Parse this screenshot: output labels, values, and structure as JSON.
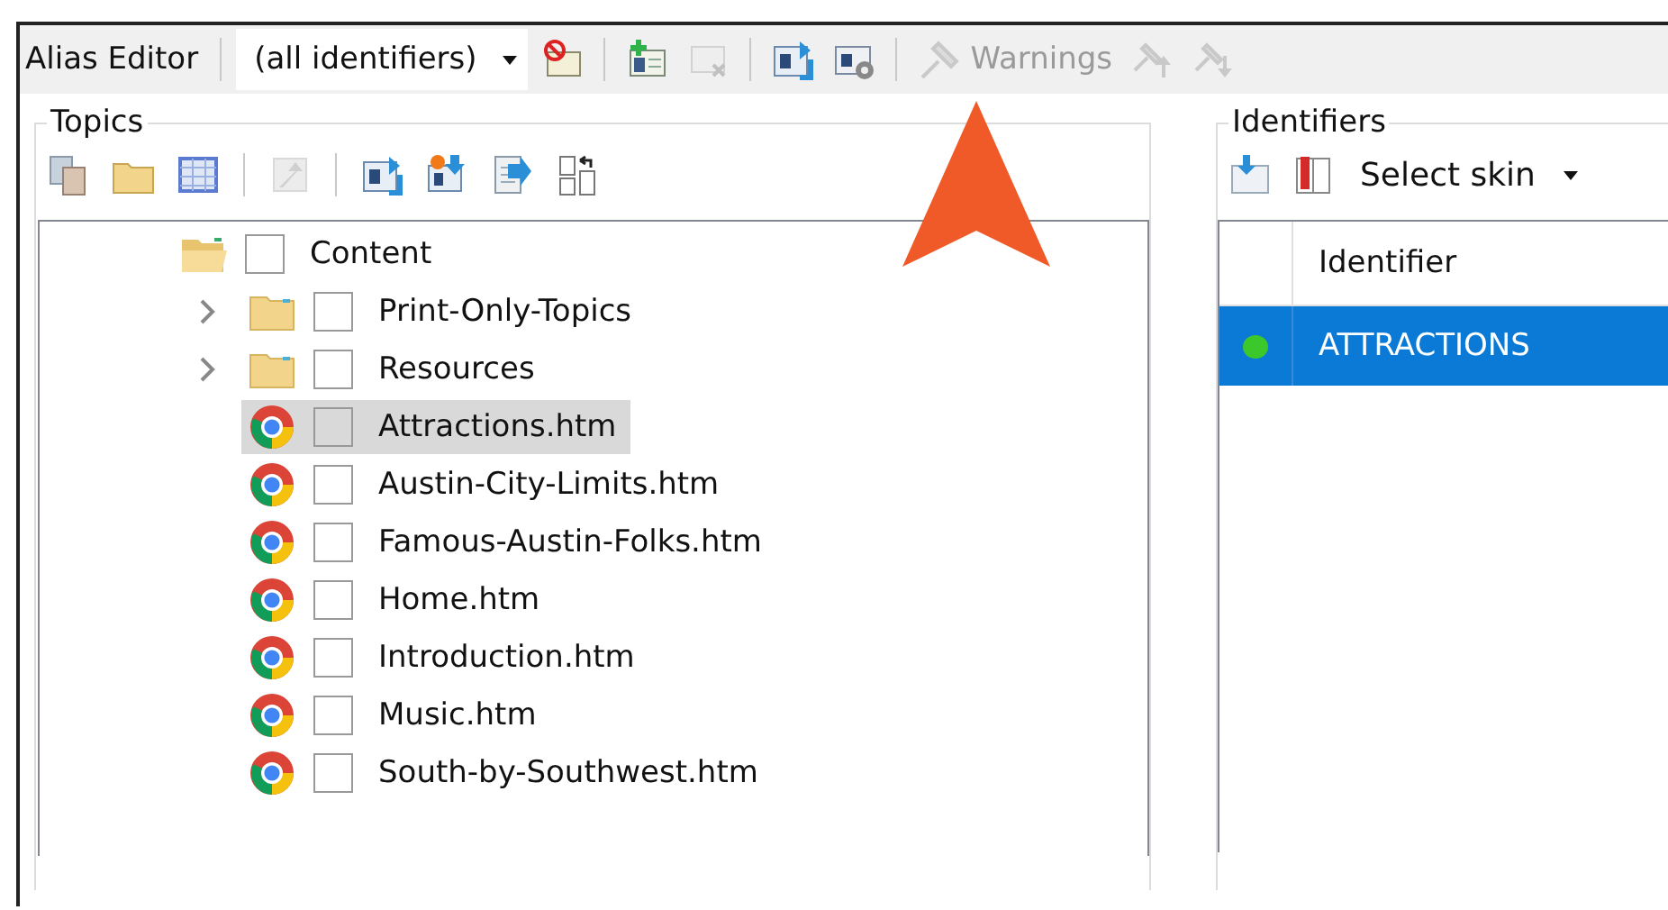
{
  "toolbar": {
    "title": "Alias Editor",
    "filter": {
      "value": "(all identifiers)"
    },
    "buttons": [
      {
        "kind": "no-id",
        "disabled": false
      },
      {
        "kind": "add-id",
        "disabled": false
      },
      {
        "kind": "delete-id",
        "disabled": true
      },
      {
        "kind": "assign",
        "disabled": false
      },
      {
        "kind": "id-settings",
        "disabled": false
      },
      {
        "kind": "warnings",
        "label": "Warnings",
        "disabled": true
      },
      {
        "kind": "warning-prev",
        "disabled": true
      },
      {
        "kind": "warning-next",
        "disabled": true
      }
    ]
  },
  "topics": {
    "title": "Topics",
    "tools": [
      {
        "kind": "copy",
        "disabled": false
      },
      {
        "kind": "folder",
        "disabled": false
      },
      {
        "kind": "grid",
        "disabled": false
      },
      {
        "kind": "move-up",
        "disabled": true
      },
      {
        "kind": "assign",
        "disabled": false
      },
      {
        "kind": "assign-new",
        "disabled": false
      },
      {
        "kind": "page-assign",
        "disabled": false
      },
      {
        "kind": "swap",
        "disabled": false
      }
    ],
    "tree": [
      {
        "label": "Content",
        "kind": "folder-open",
        "checked": false,
        "selected": false,
        "children": [
          {
            "label": "Print-Only-Topics",
            "kind": "folder",
            "expanded": false,
            "checked": false,
            "selected": false
          },
          {
            "label": "Resources",
            "kind": "folder",
            "expanded": false,
            "checked": false,
            "selected": false
          },
          {
            "label": "Attractions.htm",
            "kind": "page",
            "checked": false,
            "selected": true
          },
          {
            "label": "Austin-City-Limits.htm",
            "kind": "page",
            "checked": false,
            "selected": false
          },
          {
            "label": "Famous-Austin-Folks.htm",
            "kind": "page",
            "checked": false,
            "selected": false
          },
          {
            "label": "Home.htm",
            "kind": "page",
            "checked": false,
            "selected": false
          },
          {
            "label": "Introduction.htm",
            "kind": "page",
            "checked": false,
            "selected": false
          },
          {
            "label": "Music.htm",
            "kind": "page",
            "checked": false,
            "selected": false
          },
          {
            "label": "South-by-Southwest.htm",
            "kind": "page",
            "checked": false,
            "selected": false
          }
        ]
      }
    ]
  },
  "identifiers": {
    "title": "Identifiers",
    "skin": {
      "value": "Select skin"
    },
    "table": {
      "columns": [
        "Identifier"
      ],
      "rows": [
        {
          "identifier": "ATTRACTIONS",
          "color": "#3cc82a",
          "selected": true
        }
      ]
    }
  }
}
